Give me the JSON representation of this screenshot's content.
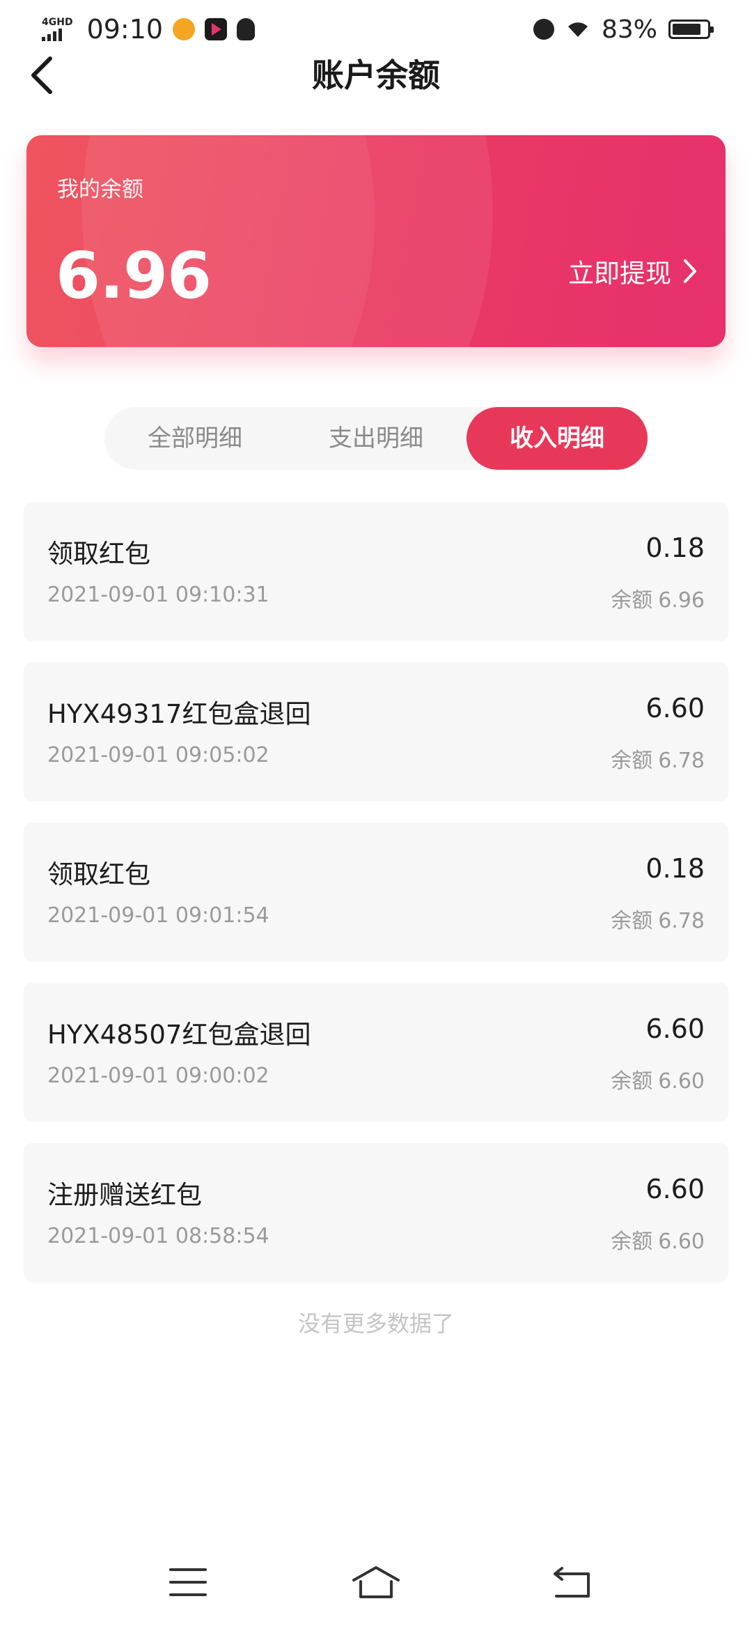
{
  "status_bar": {
    "network_label": "4GHD",
    "time": "09:10",
    "battery_text": "83%",
    "battery_level": 0.83
  },
  "header": {
    "title": "账户余额"
  },
  "balance_card": {
    "label": "我的余额",
    "amount": "6.96",
    "withdraw_label": "立即提现"
  },
  "tabs": [
    {
      "label": "全部明细",
      "active": false
    },
    {
      "label": "支出明细",
      "active": false
    },
    {
      "label": "收入明细",
      "active": true
    }
  ],
  "balance_prefix": "余额",
  "records": [
    {
      "title": "领取红包",
      "time": "2021-09-01 09:10:31",
      "amount": "0.18",
      "balance": "6.96"
    },
    {
      "title": "HYX49317红包盒退回",
      "time": "2021-09-01 09:05:02",
      "amount": "6.60",
      "balance": "6.78"
    },
    {
      "title": "领取红包",
      "time": "2021-09-01 09:01:54",
      "amount": "0.18",
      "balance": "6.78"
    },
    {
      "title": "HYX48507红包盒退回",
      "time": "2021-09-01 09:00:02",
      "amount": "6.60",
      "balance": "6.60"
    },
    {
      "title": "注册赠送红包",
      "time": "2021-09-01 08:58:54",
      "amount": "6.60",
      "balance": "6.60"
    }
  ],
  "footer_text": "没有更多数据了",
  "colors": {
    "accent": "#e8385a",
    "card_start": "#ee4a55",
    "card_end": "#e7306d"
  }
}
